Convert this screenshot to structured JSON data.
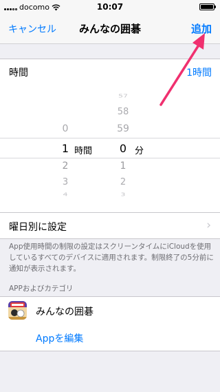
{
  "status_bar": {
    "carrier": "docomo",
    "time": "10:07",
    "wifi_icon": "wifi-icon",
    "battery_level": 1.0
  },
  "nav": {
    "cancel_label": "キャンセル",
    "title": "みんなの囲碁",
    "add_label": "追加"
  },
  "time_row": {
    "label": "時間",
    "value": "1時間"
  },
  "picker": {
    "hours": {
      "above": [
        "0"
      ],
      "selected": "1",
      "below": [
        "2",
        "3",
        "4"
      ],
      "unit": "時間"
    },
    "minutes": {
      "above": [
        "57",
        "58",
        "59"
      ],
      "selected": "0",
      "below": [
        "1",
        "2",
        "3"
      ],
      "unit": "分"
    }
  },
  "weekday_row": {
    "label": "曜日別に設定"
  },
  "footer_note": "App使用時間の制限の設定はスクリーンタイムにiCloudを使用しているすべてのデバイスに適用されます。制限終了の5分前に通知が表示されます。",
  "apps_section": {
    "header": "APPおよびカテゴリ",
    "app_name": "みんなの囲碁",
    "edit_label": "Appを編集"
  },
  "colors": {
    "accent": "#007aff",
    "annotation_arrow": "#f0306f",
    "background": "#efeff4"
  }
}
